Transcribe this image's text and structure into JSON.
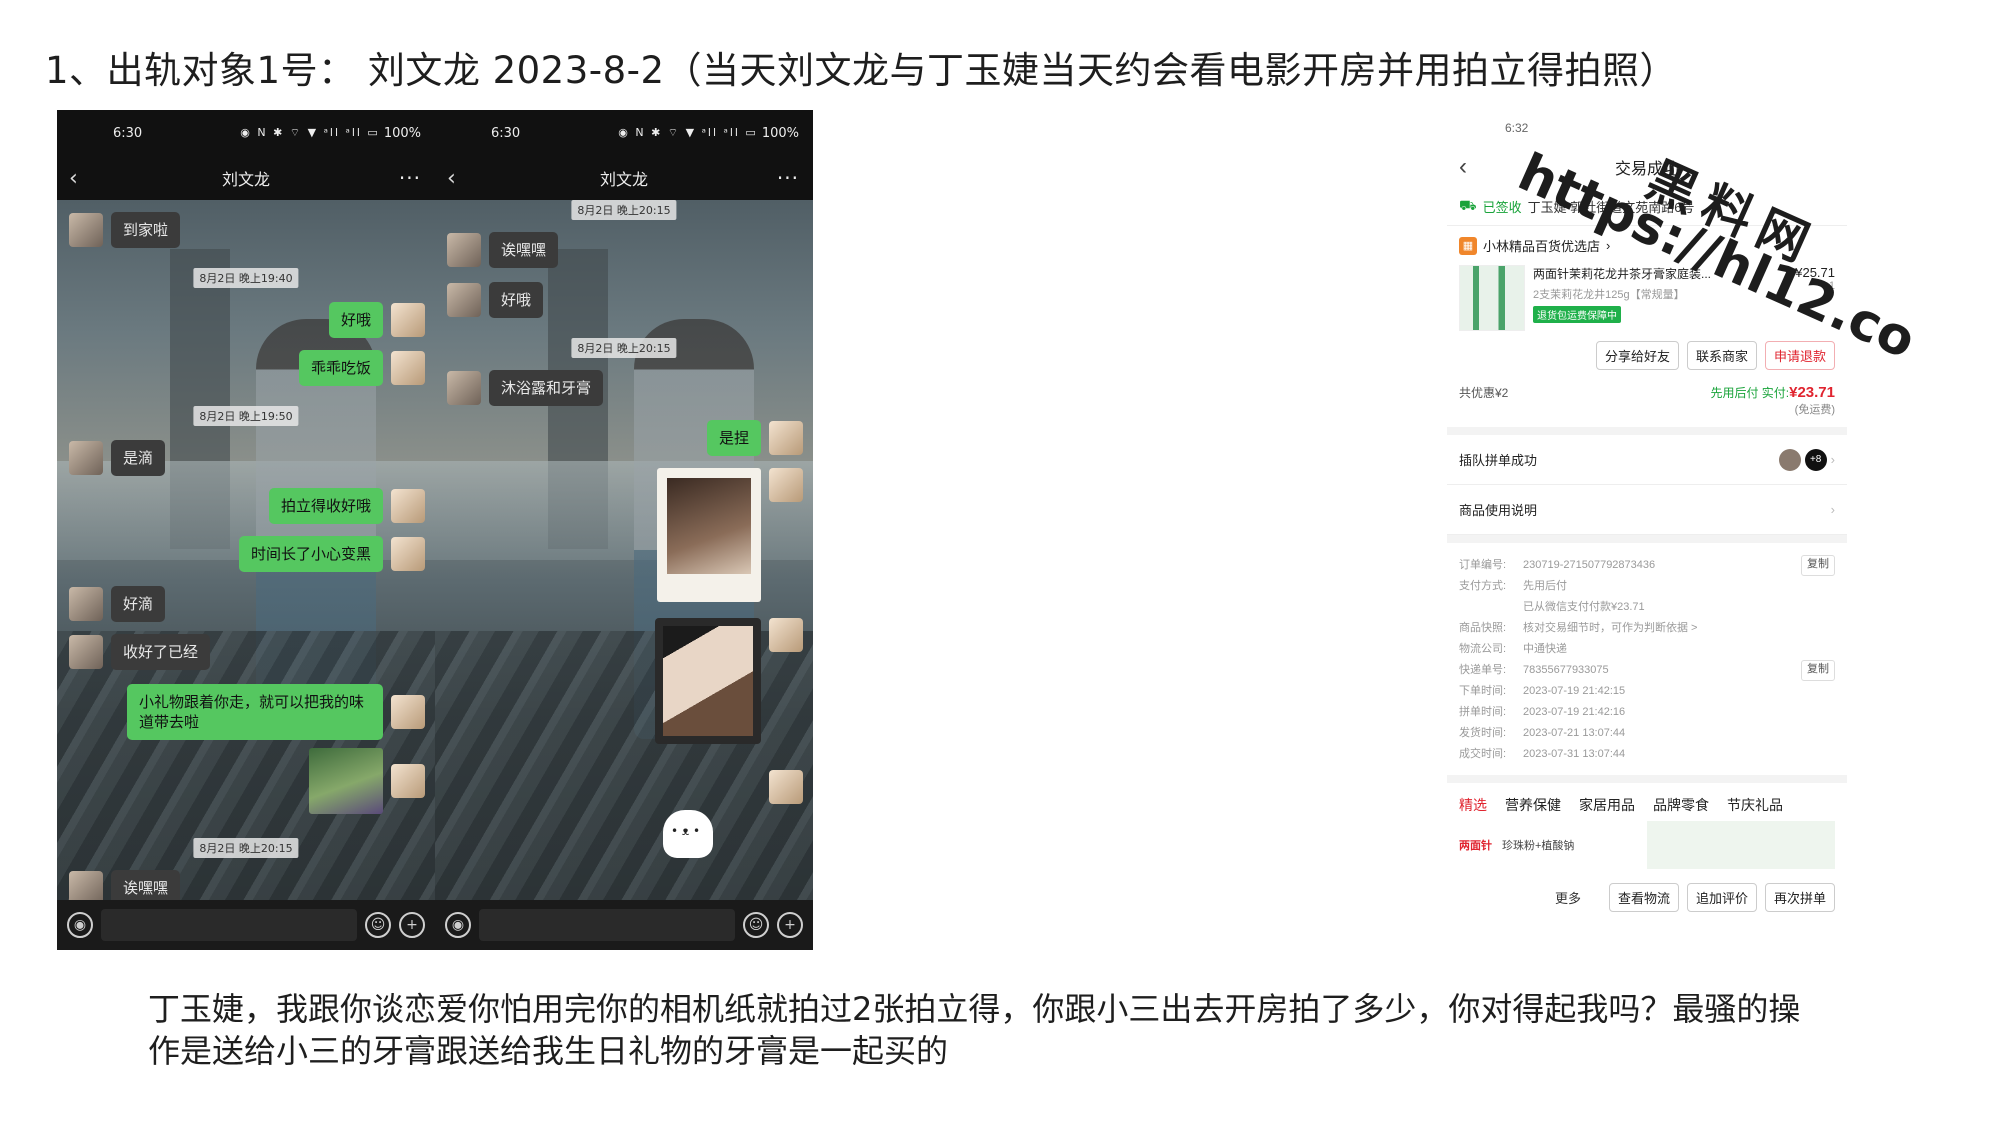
{
  "page": {
    "title": "1、出轨对象1号：  刘文龙  2023-8-2（当天刘文龙与丁玉婕当天约会看电影开房并用拍立得拍照）",
    "caption": "丁玉婕，我跟你谈恋爱你怕用完你的相机纸就拍过2张拍立得，你跟小三出去开房拍了多少，你对得起我吗？最骚的操作是送给小三的牙膏跟送给我生日礼物的牙膏是一起买的"
  },
  "watermark": {
    "cn": "黑料网",
    "url": "https://hl12.co"
  },
  "chat1": {
    "time": "6:30",
    "status_icons": "◉ N ✱ ⌔ ▼ ᵃll ᵃll ▭",
    "battery": "100%",
    "contact": "刘文龙",
    "messages": [
      {
        "side": "in",
        "text": "到家啦"
      },
      {
        "stamp": "8月2日 晚上19:40"
      },
      {
        "side": "out",
        "text": "好哦"
      },
      {
        "side": "out",
        "text": "乖乖吃饭"
      },
      {
        "stamp": "8月2日 晚上19:50"
      },
      {
        "side": "in",
        "text": "是滴"
      },
      {
        "side": "out",
        "text": "拍立得收好哦"
      },
      {
        "side": "out",
        "text": "时间长了小心变黑"
      },
      {
        "side": "in",
        "text": "好滴"
      },
      {
        "side": "in",
        "text": "收好了已经"
      },
      {
        "side": "out",
        "text": "小礼物跟着你走，就可以把我的味道带去啦"
      },
      {
        "stamp": "8月2日 晚上20:15"
      },
      {
        "side": "in",
        "text": "诶嘿嘿"
      }
    ]
  },
  "chat2": {
    "time": "6:30",
    "status_icons": "◉ N ✱ ⌔ ▼ ᵃll ᵃll ▭",
    "battery": "100%",
    "contact": "刘文龙",
    "messages": [
      {
        "stamp": "8月2日 晚上20:15"
      },
      {
        "side": "in",
        "text": "诶嘿嘿"
      },
      {
        "side": "in",
        "text": "好哦"
      },
      {
        "stamp": "8月2日 晚上20:15"
      },
      {
        "side": "in",
        "text": "沐浴露和牙膏"
      },
      {
        "side": "out",
        "text": "是捏"
      }
    ]
  },
  "order": {
    "time": "6:32",
    "title": "交易成功",
    "signed_label": "已签收",
    "address": "丁玉婕  郭社街道文苑南路6号",
    "shop": "小林精品百货优选店",
    "item_title": "两面针茉莉花龙井茶牙膏家庭装...",
    "item_spec": "2支茉莉花龙井125g【常规量】",
    "guarantee": "退货包运费保障中",
    "price": "¥25.71",
    "qty": "×1",
    "btn_share": "分享给好友",
    "btn_contact": "联系商家",
    "btn_refund": "申请退款",
    "discount": "共优惠¥2",
    "paid_prefix": "先用后付 实付:",
    "paid_amount": "¥23.71",
    "shipping": "(免运费)",
    "group_label": "插队拼单成功",
    "group_count": "+8",
    "usage_label": "商品使用说明",
    "details": [
      {
        "k": "订单编号:",
        "v": "230719-271507792873436",
        "copy": "复制"
      },
      {
        "k": "支付方式:",
        "v": "先用后付"
      },
      {
        "k": "",
        "v": "已从微信支付付款¥23.71"
      },
      {
        "k": "商品快照:",
        "v": "核对交易细节时，可作为判断依据 >"
      },
      {
        "k": "物流公司:",
        "v": "中通快递"
      },
      {
        "k": "快递单号:",
        "v": "78355677933075",
        "copy": "复制"
      },
      {
        "k": "下单时间:",
        "v": "2023-07-19 21:42:15"
      },
      {
        "k": "拼单时间:",
        "v": "2023-07-19 21:42:16"
      },
      {
        "k": "发货时间:",
        "v": "2023-07-21 13:07:44"
      },
      {
        "k": "成交时间:",
        "v": "2023-07-31 13:07:44"
      }
    ],
    "tabs": [
      "精选",
      "营养保健",
      "家居用品",
      "品牌零食",
      "节庆礼品"
    ],
    "promo_brand": "两面针",
    "promo_text": "珍珠粉+植酸钠",
    "footer_more": "更多",
    "footer_buttons": [
      "查看物流",
      "追加评价",
      "再次拼单"
    ]
  }
}
